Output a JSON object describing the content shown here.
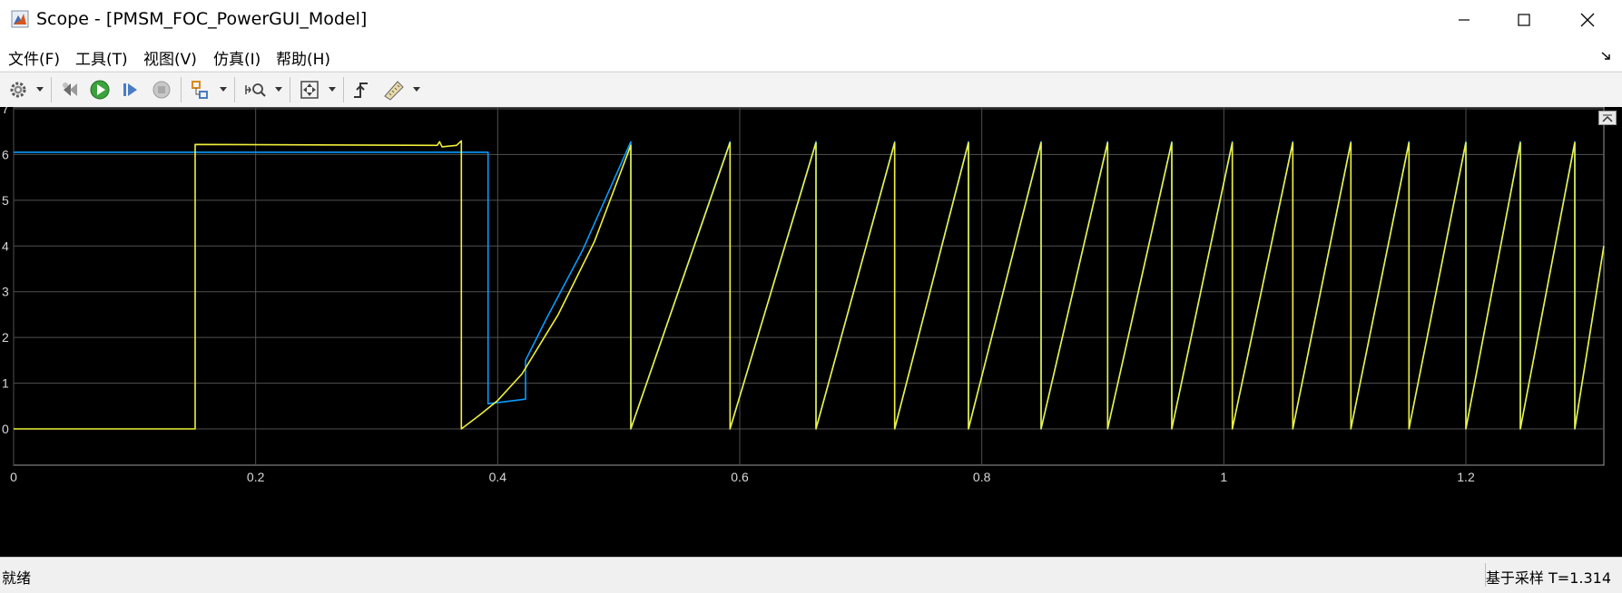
{
  "window": {
    "title": "Scope - [PMSM_FOC_PowerGUI_Model]"
  },
  "menu": {
    "items": [
      "文件(F)",
      "工具(T)",
      "视图(V)",
      "仿真(I)",
      "帮助(H)"
    ]
  },
  "toolbar": {
    "buttons": [
      "settings",
      "step-back",
      "run",
      "step-forward",
      "stop",
      "highlight-block",
      "zoom",
      "autoscale",
      "triggers",
      "measurements"
    ]
  },
  "status": {
    "left": "就绪",
    "right": "基于采样  T=1.314"
  },
  "chart_data": {
    "type": "line",
    "xlim": [
      0,
      1.314
    ],
    "ylim": [
      0,
      7
    ],
    "xticks": [
      0,
      0.2,
      0.4,
      0.6,
      0.8,
      1,
      1.2
    ],
    "xtick_labels": [
      "0",
      "0.2",
      "0.4",
      "0.6",
      "0.8",
      "1",
      "1.2"
    ],
    "yticks": [
      0,
      1,
      2,
      3,
      4,
      5,
      6,
      7
    ],
    "ytick_labels": [
      "0",
      "1",
      "2",
      "3",
      "4",
      "5",
      "6",
      "7"
    ],
    "grid": true,
    "background": "#000000",
    "grid_color": "#505050",
    "series": [
      {
        "color": "#0a9bff",
        "x": [
          0,
          0.392,
          0.392,
          0.423,
          0.423,
          0.44,
          0.47,
          0.51,
          0.51,
          0.592,
          0.592,
          0.663,
          0.663,
          0.728,
          0.728,
          0.789,
          0.789,
          0.849,
          0.849,
          0.904,
          0.904,
          0.957,
          0.957,
          1.007,
          1.007,
          1.057,
          1.057,
          1.105,
          1.105,
          1.153,
          1.153,
          1.2,
          1.2,
          1.245,
          1.245,
          1.29,
          1.29,
          1.314
        ],
        "y": [
          6.05,
          6.05,
          0.55,
          0.65,
          1.5,
          2.4,
          3.9,
          6.28,
          0,
          6.28,
          0,
          6.28,
          0,
          6.28,
          0,
          6.28,
          0,
          6.28,
          0,
          6.28,
          0,
          6.28,
          0,
          6.28,
          0,
          6.28,
          0,
          6.28,
          0,
          6.28,
          0,
          6.28,
          0,
          6.28,
          0,
          6.28,
          0,
          4.0
        ]
      },
      {
        "color": "#f0f03c",
        "x": [
          0,
          0.15,
          0.15,
          0.35,
          0.352,
          0.354,
          0.366,
          0.37,
          0.37,
          0.385,
          0.4,
          0.42,
          0.45,
          0.48,
          0.51,
          0.51,
          0.592,
          0.592,
          0.663,
          0.663,
          0.728,
          0.728,
          0.789,
          0.789,
          0.849,
          0.849,
          0.904,
          0.904,
          0.957,
          0.957,
          1.007,
          1.007,
          1.057,
          1.057,
          1.105,
          1.105,
          1.153,
          1.153,
          1.2,
          1.2,
          1.245,
          1.245,
          1.29,
          1.29,
          1.314
        ],
        "y": [
          0,
          0,
          6.22,
          6.2,
          6.28,
          6.17,
          6.2,
          6.3,
          0,
          0.3,
          0.62,
          1.2,
          2.5,
          4.1,
          6.2,
          0,
          6.26,
          0,
          6.26,
          0,
          6.26,
          0,
          6.26,
          0,
          6.26,
          0,
          6.26,
          0,
          6.26,
          0,
          6.26,
          0,
          6.26,
          0,
          6.26,
          0,
          6.26,
          0,
          6.26,
          0,
          6.26,
          0,
          6.26,
          0,
          4.0
        ]
      }
    ]
  }
}
